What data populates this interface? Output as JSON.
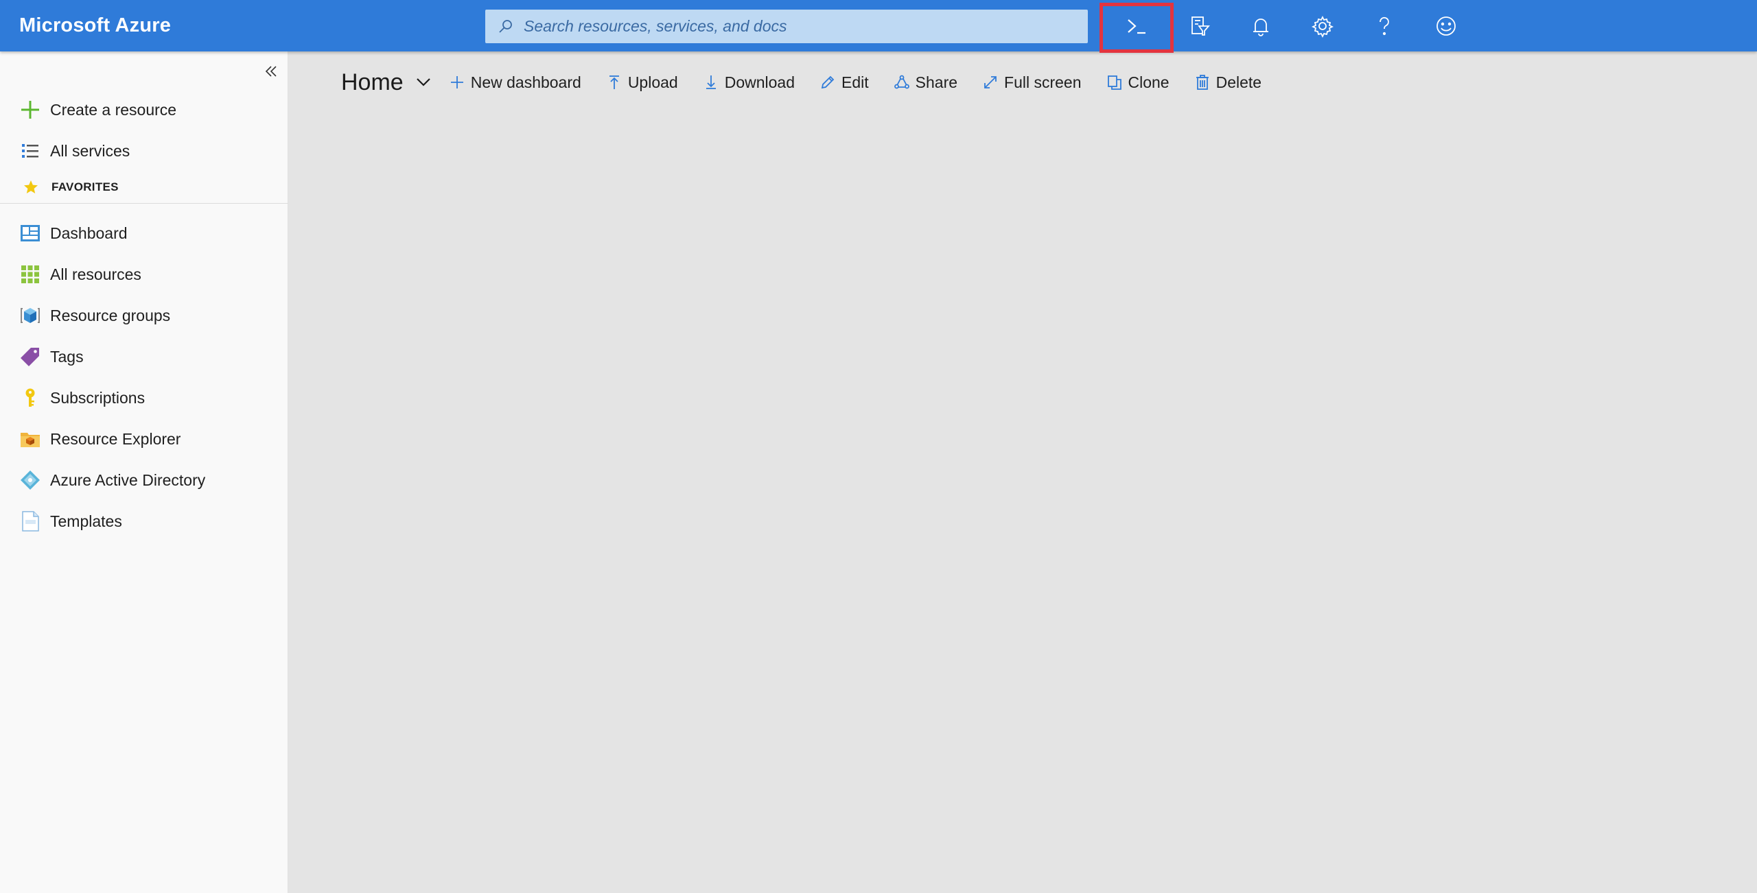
{
  "topbar": {
    "brand": "Microsoft Azure",
    "search_placeholder": "Search resources, services, and docs",
    "icons": [
      "search-icon",
      "cloud-shell-icon",
      "directory-filter-icon",
      "bell-icon",
      "gear-icon",
      "help-icon",
      "smiley-icon"
    ],
    "highlight_color": "#e3343f"
  },
  "sidebar": {
    "create": "Create a resource",
    "all_services": "All services",
    "favorites_label": "FAVORITES",
    "items": [
      {
        "label": "Dashboard",
        "icon": "dashboard-icon"
      },
      {
        "label": "All resources",
        "icon": "all-resources-icon"
      },
      {
        "label": "Resource groups",
        "icon": "resource-groups-icon"
      },
      {
        "label": "Tags",
        "icon": "tag-icon"
      },
      {
        "label": "Subscriptions",
        "icon": "key-icon"
      },
      {
        "label": "Resource Explorer",
        "icon": "folder-icon"
      },
      {
        "label": "Azure Active Directory",
        "icon": "aad-icon"
      },
      {
        "label": "Templates",
        "icon": "json-file-icon"
      }
    ]
  },
  "dashboard": {
    "title": "Home",
    "commands": [
      "New dashboard",
      "Upload",
      "Download",
      "Edit",
      "Share",
      "Full screen",
      "Clone",
      "Delete"
    ]
  },
  "colors": {
    "topbar": "#2f7bd9",
    "search_bg": "#bed9f3",
    "canvas": "#e4e4e4",
    "sidebar": "#f9f9f9",
    "icon_blue": "#2f7bd9"
  }
}
